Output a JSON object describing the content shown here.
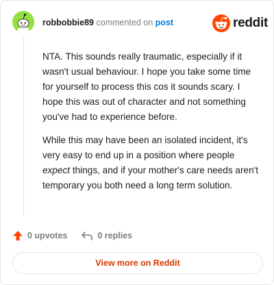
{
  "header": {
    "username": "robbobbie89",
    "action": "commented on",
    "post_link": "post",
    "brand": "reddit"
  },
  "comment": {
    "p1": "NTA. This sounds really traumatic, especially if it wasn't usual behaviour. I hope you take some time for yourself to process this cos it sounds scary. I hope this was out of character and not something you've had to experience before.",
    "p2_before": "While this may have been an isolated incident, it's very easy to end up in a position where people ",
    "p2_em": "expect",
    "p2_after": " things, and if your mother's care needs aren't temporary you both need a long term solution."
  },
  "footer": {
    "upvotes": "0 upvotes",
    "replies": "0 replies"
  },
  "view_more": "View more on Reddit",
  "colors": {
    "avatar": "#94e044",
    "brand_orange": "#ff4500",
    "link_blue": "#0079d3",
    "view_more": "#d93a00"
  },
  "icons": [
    "snoo-avatar-icon",
    "reddit-logo-icon",
    "upvote-arrow-icon",
    "reply-arrow-icon"
  ]
}
